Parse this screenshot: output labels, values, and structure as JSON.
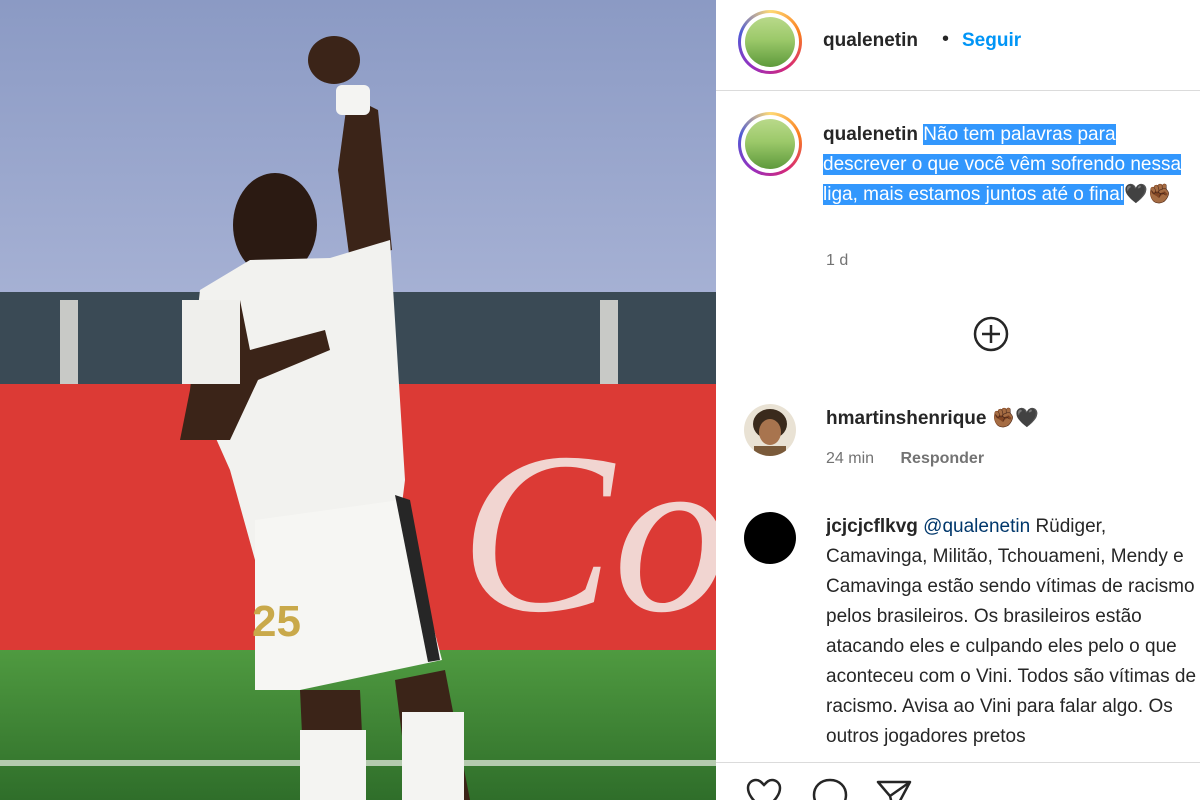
{
  "post": {
    "username": "qualenetin",
    "dot": "•",
    "follow_label": "Seguir",
    "caption_highlighted": "Não tem palavras para descrever o que você vêm sofrendo nessa liga, mais estamos juntos até o final",
    "caption_emoji": "🖤✊🏾",
    "time": "1 d"
  },
  "comments": [
    {
      "username": "hmartinshenrique",
      "text": "✊🏾🖤",
      "time": "24 min",
      "reply_label": "Responder"
    },
    {
      "username": "jcjcjcflkvg",
      "mention": "@qualenetin",
      "text": "Rüdiger, Camavinga, Militão, Tchouameni, Mendy e Camavinga estão sendo vítimas de racismo pelos brasileiros. Os brasileiros estão atacando eles e culpando eles pelo o que aconteceu com o Vini. Todos são vítimas de racismo. Avisa ao Vini para falar algo. Os outros jogadores pretos"
    }
  ],
  "photo": {
    "jersey_number": "25",
    "ad_text": "Coca"
  },
  "icons": [
    "plus-circle-icon",
    "heart-icon",
    "comment-icon",
    "share-icon"
  ],
  "colors": {
    "accent": "#0095f6",
    "highlight": "#3297fd",
    "muted": "#737373"
  }
}
